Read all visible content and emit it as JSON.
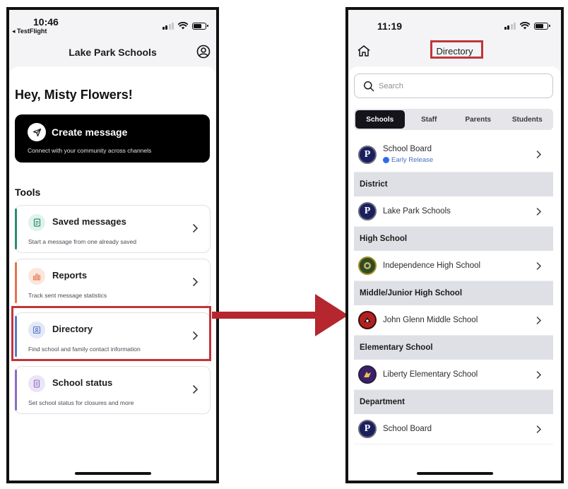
{
  "left_phone": {
    "time": "10:46",
    "back_label": "◂ TestFlight",
    "title": "Lake Park Schools",
    "greeting": "Hey, Misty Flowers!",
    "create": {
      "label": "Create message",
      "subtitle": "Connect with your community across channels"
    },
    "tools_heading": "Tools",
    "tools": [
      {
        "label": "Saved messages",
        "subtitle": "Start a message from one already saved",
        "icon": "document-icon",
        "accent": "#2e8b75"
      },
      {
        "label": "Reports",
        "subtitle": "Track sent message statistics",
        "icon": "bar-chart-icon",
        "accent": "#e8734a"
      },
      {
        "label": "Directory",
        "subtitle": "Find school and family contact information",
        "icon": "contact-card-icon",
        "accent": "#5877c9"
      },
      {
        "label": "School status",
        "subtitle": "Set school status for closures and more",
        "icon": "status-icon",
        "accent": "#8a6bc9"
      }
    ]
  },
  "right_phone": {
    "time": "11:19",
    "title": "Directory",
    "search_placeholder": "Search",
    "tabs": [
      "Schools",
      "Staff",
      "Parents",
      "Students"
    ],
    "active_tab": "Schools",
    "top_entry": {
      "name": "School Board",
      "status": "Early Release"
    },
    "sections": [
      {
        "heading": "District",
        "items": [
          "Lake Park Schools"
        ]
      },
      {
        "heading": "High School",
        "items": [
          "Independence High School"
        ]
      },
      {
        "heading": "Middle/Junior High School",
        "items": [
          "John Glenn Middle School"
        ]
      },
      {
        "heading": "Elementary School",
        "items": [
          "Liberty Elementary School"
        ]
      },
      {
        "heading": "Department",
        "items": [
          "School Board"
        ]
      }
    ]
  },
  "colors": {
    "highlight": "#c0353a",
    "arrow": "#b5262e",
    "status_dot": "#2f6bea"
  }
}
